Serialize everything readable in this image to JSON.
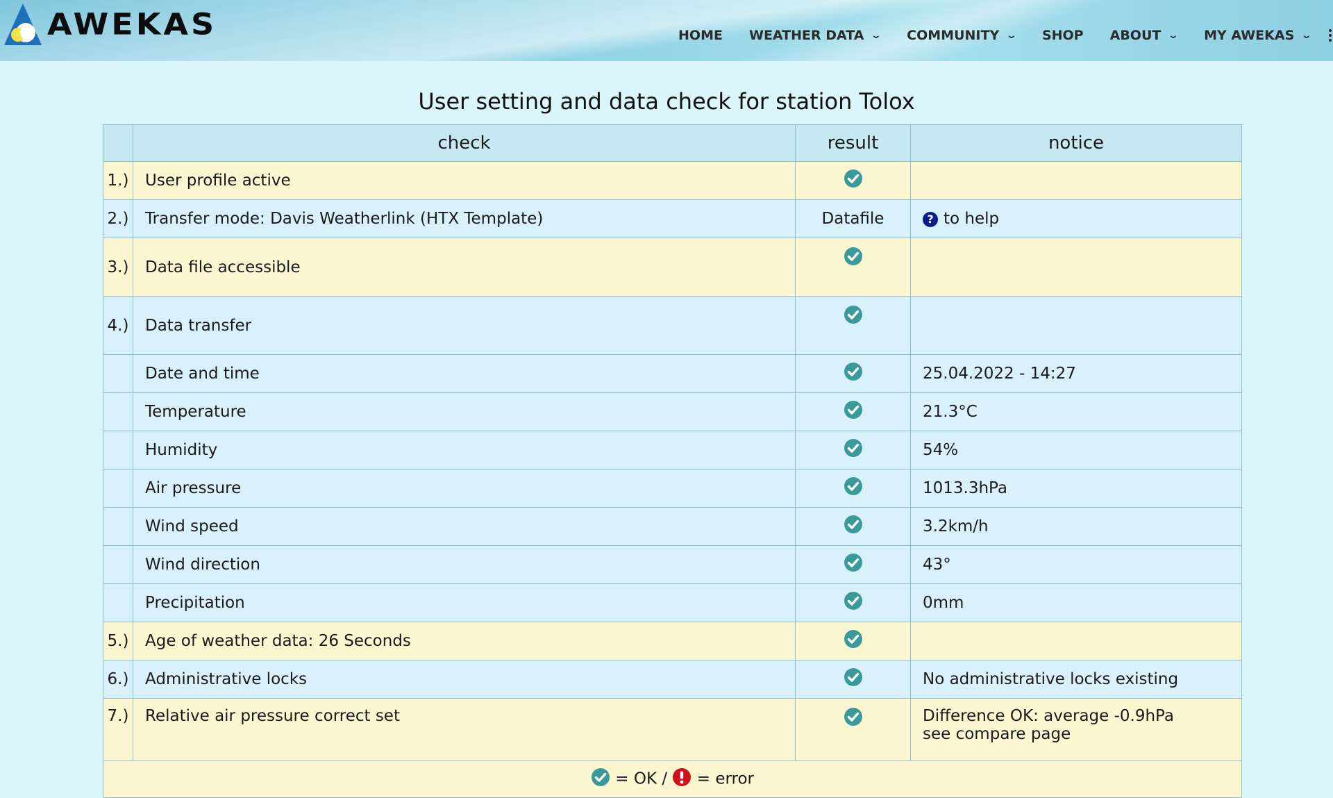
{
  "header": {
    "logo_text": "AWEKAS",
    "nav": [
      {
        "label": "HOME",
        "dropdown": false
      },
      {
        "label": "WEATHER DATA",
        "dropdown": true
      },
      {
        "label": "COMMUNITY",
        "dropdown": true
      },
      {
        "label": "SHOP",
        "dropdown": false
      },
      {
        "label": "ABOUT",
        "dropdown": true
      },
      {
        "label": "MY AWEKAS",
        "dropdown": true
      }
    ]
  },
  "page": {
    "title": "User setting and data check for station Tolox"
  },
  "table": {
    "headers": {
      "num": "",
      "check": "check",
      "result": "result",
      "notice": "notice"
    },
    "rows": [
      {
        "num": "1.)",
        "check": "User profile active",
        "result": "ok",
        "notice": ""
      },
      {
        "num": "2.)",
        "check": "Transfer mode: Davis Weatherlink (HTX Template)",
        "result": "Datafile",
        "notice": "to help"
      },
      {
        "num": "3.)",
        "check": "Data file accessible",
        "result": "ok",
        "notice": ""
      },
      {
        "num": "4.)",
        "check": "Data transfer",
        "result": "ok",
        "notice": ""
      },
      {
        "num": "",
        "check": "Date and time",
        "result": "ok",
        "notice": "25.04.2022 - 14:27"
      },
      {
        "num": "",
        "check": "Temperature",
        "result": "ok",
        "notice": "21.3°C"
      },
      {
        "num": "",
        "check": "Humidity",
        "result": "ok",
        "notice": "54%"
      },
      {
        "num": "",
        "check": "Air pressure",
        "result": "ok",
        "notice": "1013.3hPa"
      },
      {
        "num": "",
        "check": "Wind speed",
        "result": "ok",
        "notice": "3.2km/h"
      },
      {
        "num": "",
        "check": "Wind direction",
        "result": "ok",
        "notice": "43°"
      },
      {
        "num": "",
        "check": "Precipitation",
        "result": "ok",
        "notice": "0mm"
      },
      {
        "num": "5.)",
        "check": "Age of weather data: 26 Seconds",
        "result": "ok",
        "notice": ""
      },
      {
        "num": "6.)",
        "check": "Administrative locks",
        "result": "ok",
        "notice": "No administrative locks existing"
      },
      {
        "num": "7.)",
        "check": "Relative air pressure correct set",
        "result": "ok",
        "notice": "Difference OK: average -0.9hPa",
        "notice_link": "see compare page"
      }
    ],
    "legend": {
      "ok_text": "= OK /",
      "error_text": "= error"
    }
  },
  "colors": {
    "ok_icon": "#3a9a9a",
    "error_icon": "#d0101a",
    "help_icon": "#0a1f8f",
    "row_yellow": "#fcf7d0",
    "row_blue": "#d9f1fb",
    "header_row": "#c6e8f1"
  }
}
